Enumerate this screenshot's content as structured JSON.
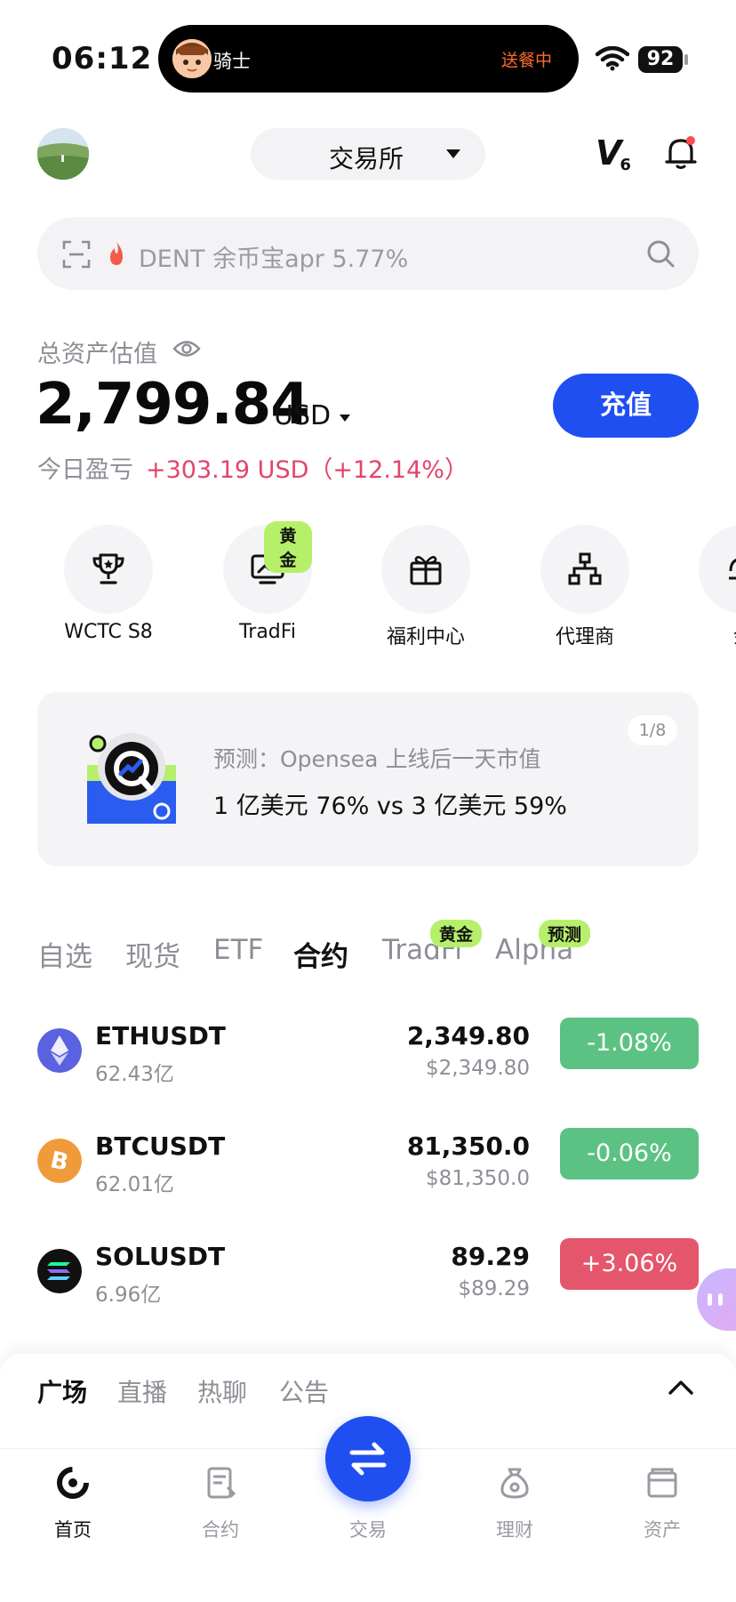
{
  "status_bar": {
    "time": "06:12",
    "island_title": "骑士",
    "island_status": "送餐中",
    "battery": "92"
  },
  "header": {
    "exchange_label": "交易所",
    "vip_letter": "V",
    "vip_level": "6"
  },
  "search": {
    "placeholder": "DENT 余币宝apr 5.77%"
  },
  "assets": {
    "label": "总资产估值",
    "value": "2,799.84",
    "unit": "USD",
    "deposit_label": "充值",
    "pnl_label": "今日盈亏",
    "pnl_value": "+303.19 USD（+12.14%）"
  },
  "quick_actions": [
    {
      "label": "WCTC S8",
      "icon": "trophy-icon"
    },
    {
      "label": "TradFi",
      "icon": "chart-monitor-icon",
      "badge": "黄金"
    },
    {
      "label": "福利中心",
      "icon": "gift-icon"
    },
    {
      "label": "代理商",
      "icon": "org-chart-icon"
    },
    {
      "label": "余",
      "icon": "more-icon"
    }
  ],
  "banner": {
    "subtitle": "预测：Opensea 上线后一天市值",
    "main": "1 亿美元 76% vs 3 亿美元 59%",
    "page": "1/8"
  },
  "market_tabs": [
    {
      "label": "自选"
    },
    {
      "label": "现货"
    },
    {
      "label": "ETF"
    },
    {
      "label": "合约",
      "active": true
    },
    {
      "label": "TradFi",
      "badge": "黄金"
    },
    {
      "label": "Alpha",
      "badge": "预测"
    }
  ],
  "rows": [
    {
      "symbol": "ETHUSDT",
      "volume": "62.43亿",
      "price": "2,349.80",
      "usd": "$2,349.80",
      "change": "-1.08%",
      "icon_color": "#5a62e0"
    },
    {
      "symbol": "BTCUSDT",
      "volume": "62.01亿",
      "price": "81,350.0",
      "usd": "$81,350.0",
      "change": "-0.06%",
      "icon_color": "#f09a3a"
    },
    {
      "symbol": "SOLUSDT",
      "volume": "6.96亿",
      "price": "89.29",
      "usd": "$89.29",
      "change": "+3.06%",
      "icon_color": "#111111"
    }
  ],
  "sheet_tabs": [
    {
      "label": "广场",
      "active": true
    },
    {
      "label": "直播"
    },
    {
      "label": "热聊"
    },
    {
      "label": "公告"
    }
  ],
  "nav": [
    {
      "label": "首页",
      "active": true
    },
    {
      "label": "合约"
    },
    {
      "label": "交易"
    },
    {
      "label": "理财"
    },
    {
      "label": "资产"
    }
  ],
  "colors": {
    "accent": "#1f4ff0",
    "up": "#e4566b",
    "down": "#5cc283",
    "badge": "#b6f06a"
  }
}
